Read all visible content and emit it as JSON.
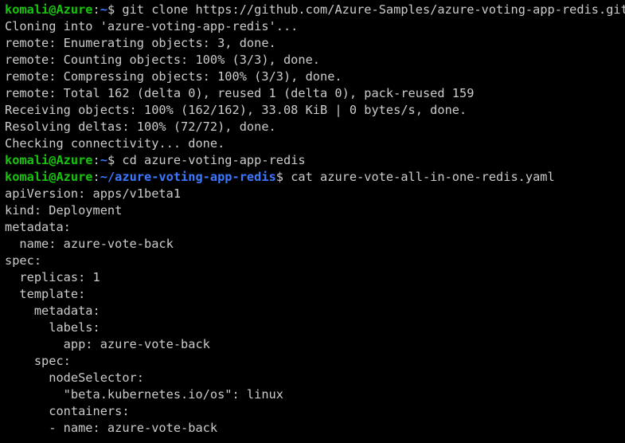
{
  "terminal": {
    "top_fragment": "'",
    "colors": {
      "background": "#000000",
      "text": "#cccccc",
      "user_host": "#16c60c",
      "path": "#3b78ff"
    },
    "lines": [
      {
        "type": "prompt",
        "user_host": "komali@Azure",
        "sep": ":",
        "path": "~",
        "dollar": "$ ",
        "command": "git clone https://github.com/Azure-Samples/azure-voting-app-redis.git"
      },
      {
        "type": "output",
        "text": "Cloning into 'azure-voting-app-redis'..."
      },
      {
        "type": "output",
        "text": "remote: Enumerating objects: 3, done."
      },
      {
        "type": "output",
        "text": "remote: Counting objects: 100% (3/3), done."
      },
      {
        "type": "output",
        "text": "remote: Compressing objects: 100% (3/3), done."
      },
      {
        "type": "output",
        "text": "remote: Total 162 (delta 0), reused 1 (delta 0), pack-reused 159"
      },
      {
        "type": "output",
        "text": "Receiving objects: 100% (162/162), 33.08 KiB | 0 bytes/s, done."
      },
      {
        "type": "output",
        "text": "Resolving deltas: 100% (72/72), done."
      },
      {
        "type": "output",
        "text": "Checking connectivity... done."
      },
      {
        "type": "prompt",
        "user_host": "komali@Azure",
        "sep": ":",
        "path": "~",
        "dollar": "$ ",
        "command": "cd azure-voting-app-redis"
      },
      {
        "type": "prompt",
        "user_host": "komali@Azure",
        "sep": ":",
        "path": "~/azure-voting-app-redis",
        "dollar": "$ ",
        "command": "cat azure-vote-all-in-one-redis.yaml"
      },
      {
        "type": "output",
        "text": "apiVersion: apps/v1beta1"
      },
      {
        "type": "output",
        "text": "kind: Deployment"
      },
      {
        "type": "output",
        "text": "metadata:"
      },
      {
        "type": "output",
        "text": "  name: azure-vote-back"
      },
      {
        "type": "output",
        "text": "spec:"
      },
      {
        "type": "output",
        "text": "  replicas: 1"
      },
      {
        "type": "output",
        "text": "  template:"
      },
      {
        "type": "output",
        "text": "    metadata:"
      },
      {
        "type": "output",
        "text": "      labels:"
      },
      {
        "type": "output",
        "text": "        app: azure-vote-back"
      },
      {
        "type": "output",
        "text": "    spec:"
      },
      {
        "type": "output",
        "text": "      nodeSelector:"
      },
      {
        "type": "output",
        "text": "        \"beta.kubernetes.io/os\": linux"
      },
      {
        "type": "output",
        "text": "      containers:"
      },
      {
        "type": "output",
        "text": "      - name: azure-vote-back"
      }
    ]
  }
}
